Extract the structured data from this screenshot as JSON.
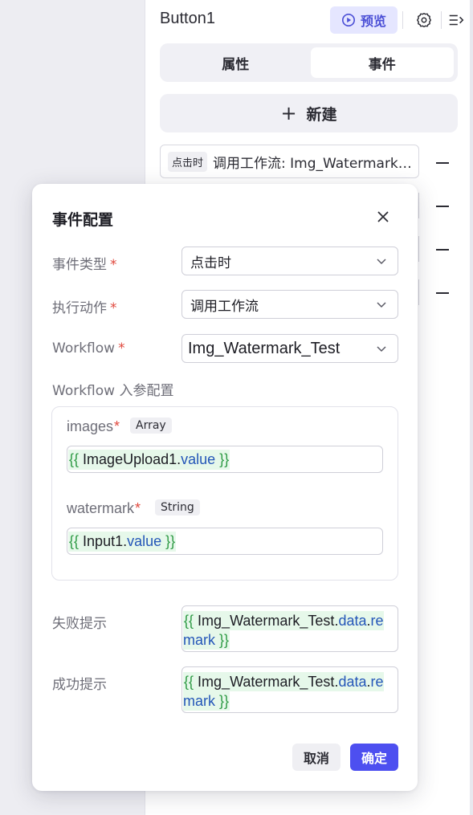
{
  "header": {
    "component_name": "Button1",
    "preview_label": "预览",
    "icons": [
      "play-circle-icon",
      "gear-icon",
      "collapse-panel-icon"
    ]
  },
  "tabs": [
    {
      "label": "属性",
      "active": false
    },
    {
      "label": "事件",
      "active": true
    }
  ],
  "new_button": {
    "icon": "plus-icon",
    "label": "新建"
  },
  "events": [
    {
      "trigger": "点击时",
      "text": "调用工作流: Img_Watermark_Test"
    }
  ],
  "dialog": {
    "title": "事件配置",
    "fields": {
      "event_type": {
        "label": "事件类型",
        "required_mark": "*",
        "value": "点击时"
      },
      "action": {
        "label": "执行动作",
        "required_mark": "*",
        "value": "调用工作流"
      },
      "workflow": {
        "label": "Workflow",
        "required_mark": "*",
        "value": "Img_Watermark_Test"
      }
    },
    "params_title": "Workflow 入参配置",
    "params": [
      {
        "name": "images",
        "required_mark": "*",
        "type": "Array",
        "expr": {
          "open": "{{",
          "obj": "ImageUpload1",
          "dot": ".",
          "prop": "value",
          "close": "}}"
        }
      },
      {
        "name": "watermark",
        "required_mark": "*",
        "type": "String",
        "expr": {
          "open": "{{",
          "obj": "Input1",
          "dot": ".",
          "prop": "value",
          "close": "}}"
        }
      }
    ],
    "fail_tip": {
      "label": "失败提示",
      "expr": {
        "open": "{{",
        "obj": "Img_Watermark_Test",
        "dot1": ".",
        "p1": "data",
        "dot2": ".",
        "p2": "remark",
        "close": "}}"
      }
    },
    "success_tip": {
      "label": "成功提示",
      "expr": {
        "open": "{{",
        "obj": "Img_Watermark_Test",
        "dot1": ".",
        "p1": "data",
        "dot2": ".",
        "p2": "remark",
        "close": "}}"
      }
    },
    "cancel_label": "取消",
    "confirm_label": "确定"
  },
  "colors": {
    "accent": "#4d4ff0",
    "preview_bg": "#e5e6ff",
    "required": "#e0483d",
    "expr_bg": "#e6f8ea",
    "expr_brace": "#2e9a44",
    "expr_prop": "#2456b8"
  }
}
